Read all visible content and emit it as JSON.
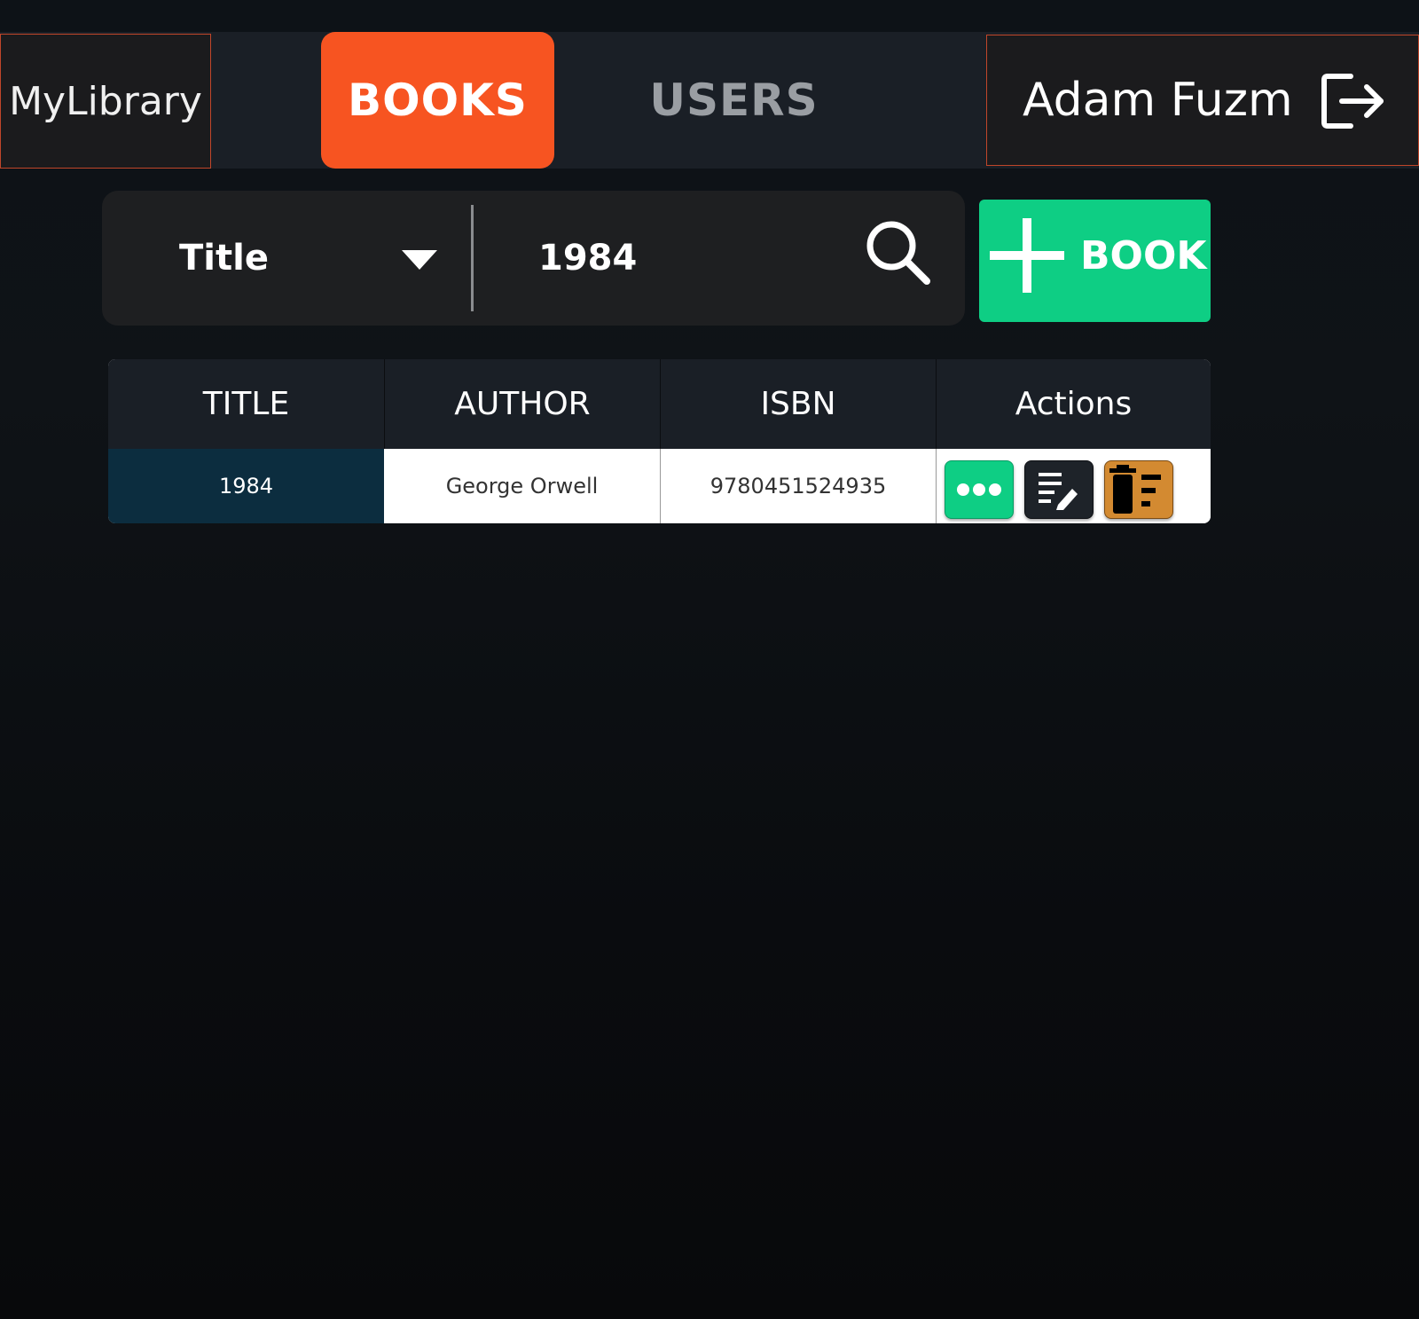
{
  "nav": {
    "brand": "MyLibrary",
    "tabs": [
      {
        "label": "BOOKS",
        "active": true
      },
      {
        "label": "USERS",
        "active": false
      }
    ],
    "user_name": "Adam Fuzm",
    "logout_icon": "logout-icon"
  },
  "search": {
    "field_selected": "Title",
    "query": "1984",
    "search_icon": "search-icon"
  },
  "add_button": {
    "icon": "plus-icon",
    "label": "BOOK"
  },
  "table": {
    "columns": [
      "TITLE",
      "AUTHOR",
      "ISBN",
      "Actions"
    ],
    "rows": [
      {
        "title": "1984",
        "author": "George Orwell",
        "isbn": "9780451524935"
      }
    ],
    "actions": [
      "more-icon",
      "edit-icon",
      "delete-icon"
    ]
  },
  "colors": {
    "accent": "#f75421",
    "success": "#0ece84",
    "warning": "#d38a31",
    "header_bg": "#1a1f26",
    "selected_cell": "#0c2d3f"
  }
}
